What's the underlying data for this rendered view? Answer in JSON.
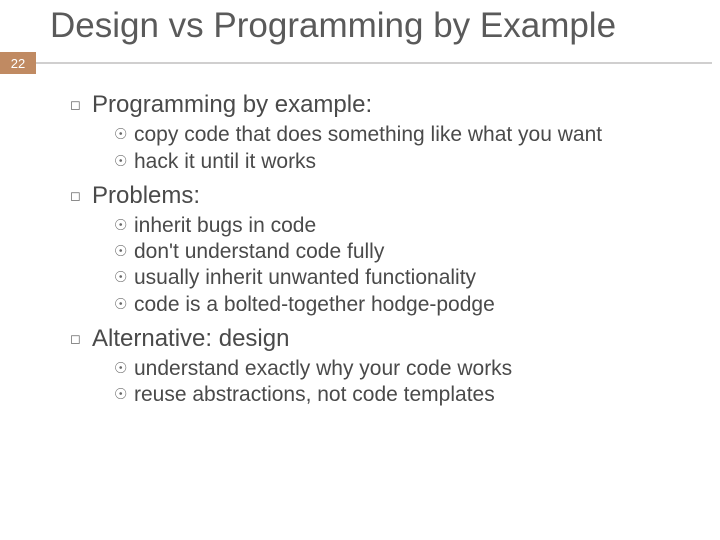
{
  "slide": {
    "title": "Design vs Programming by Example",
    "number": "22"
  },
  "sections": [
    {
      "heading": "Programming by example:",
      "items": [
        "copy code that does something like what you want",
        "hack it until it works"
      ]
    },
    {
      "heading": "Problems:",
      "items": [
        "inherit bugs in code",
        "don't understand code fully",
        "usually inherit unwanted functionality",
        "code is a bolted-together hodge-podge"
      ]
    },
    {
      "heading": "Alternative: design",
      "items": [
        "understand exactly why your code works",
        "reuse abstractions, not code templates"
      ]
    }
  ]
}
